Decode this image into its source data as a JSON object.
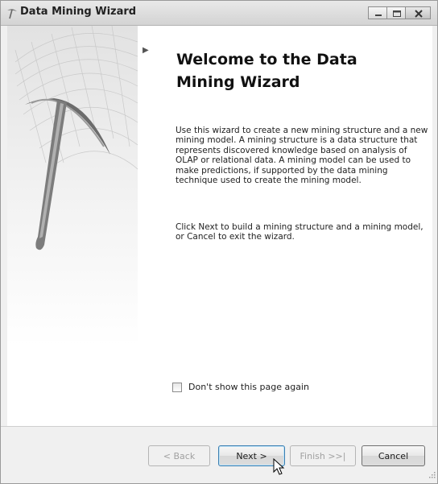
{
  "window": {
    "title": "Data Mining Wizard"
  },
  "page": {
    "heading": "Welcome to the Data Mining Wizard",
    "description_1": "Use this wizard to create a new mining structure and a new mining model. A mining structure is a data structure that represents discovered knowledge based on analysis of OLAP or relational data.  A mining model can be used to make predictions, if supported by the data mining technique used to create the mining model.",
    "description_2": "Click Next to build a mining structure and a mining model, or Cancel to exit the wizard.",
    "dont_show_again_label": "Don't show this page again",
    "dont_show_again_checked": false
  },
  "footer": {
    "back_label": "< Back",
    "next_label": "Next >",
    "finish_label": "Finish >>|",
    "cancel_label": "Cancel"
  },
  "icons": [
    "pickaxe-icon",
    "minimize-icon",
    "maximize-icon",
    "close-icon",
    "step-arrow-icon",
    "mouse-cursor-icon",
    "resize-grip-icon"
  ]
}
